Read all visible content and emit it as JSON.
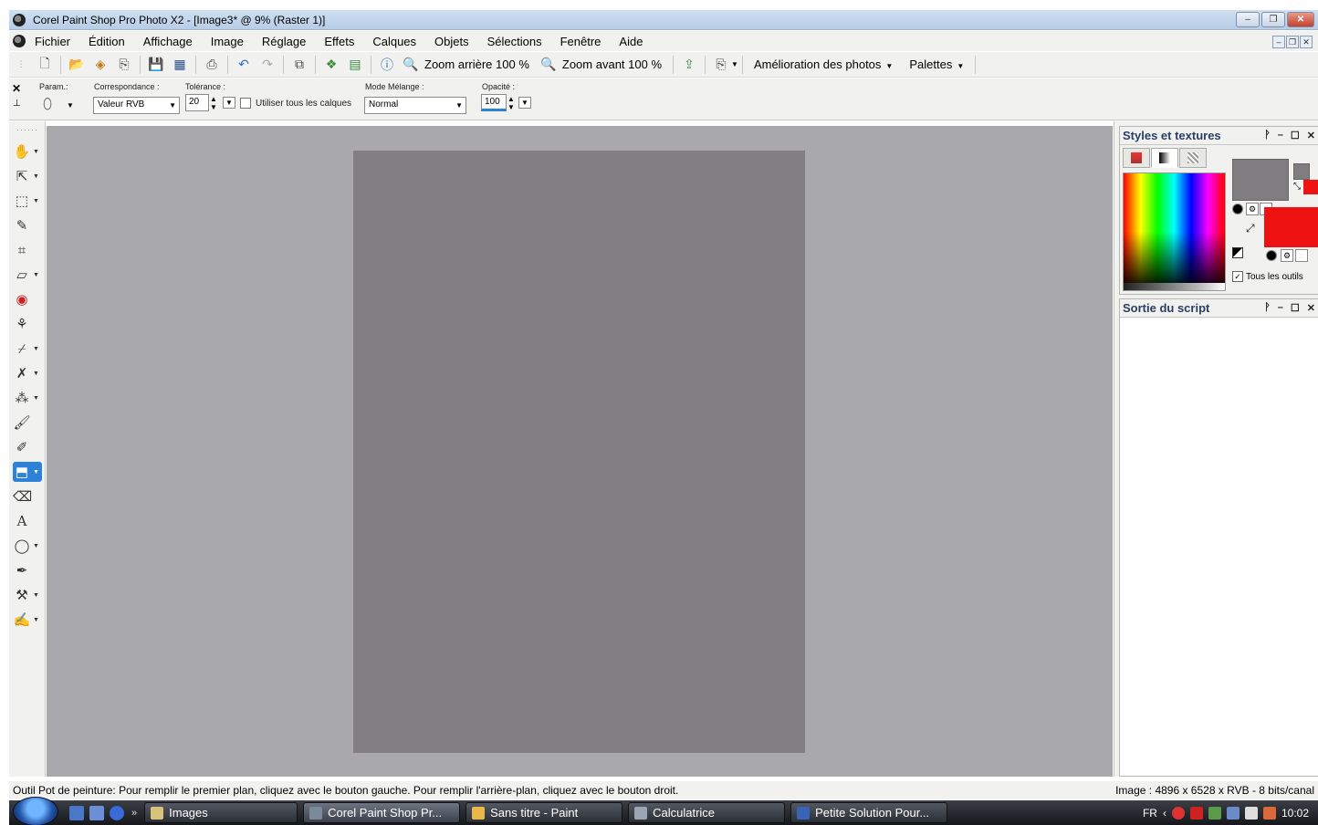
{
  "window": {
    "title": "Corel Paint Shop Pro Photo X2 - [Image3* @  9% (Raster 1)]",
    "min": "–",
    "restore": "❐",
    "close": "✕"
  },
  "menubar": {
    "items": [
      "Fichier",
      "Édition",
      "Affichage",
      "Image",
      "Réglage",
      "Effets",
      "Calques",
      "Objets",
      "Sélections",
      "Fenêtre",
      "Aide"
    ]
  },
  "toolbar": {
    "zoom_out": "Zoom arrière 100 %",
    "zoom_in": "Zoom avant 100 %",
    "enhance": "Amélioration des photos",
    "palettes": "Palettes"
  },
  "options": {
    "param_label": "Param.:",
    "match_label": "Correspondance :",
    "match_value": "Valeur RVB",
    "tolerance_label": "Tolérance :",
    "tolerance_value": "20",
    "all_layers_label": "Utiliser tous les calques",
    "blend_label": "Mode Mélange :",
    "blend_value": "Normal",
    "opacity_label": "Opacité :",
    "opacity_value": "100"
  },
  "palettes": {
    "styles_title": "Styles et textures",
    "all_tools_label": "Tous les outils",
    "all_tools_checked": "✓",
    "script_title": "Sortie du script",
    "foreground_color": "#7f7d80",
    "background_color": "#ef1212"
  },
  "canvas": {
    "color": "#827f83",
    "workspace_color": "#a9a8ab"
  },
  "status": {
    "hint": "Outil Pot de peinture: Pour remplir le premier plan, cliquez avec le bouton gauche. Pour remplir l'arrière-plan, cliquez avec le bouton droit.",
    "image_info": "Image :  4896 x 6528 x RVB - 8 bits/canal"
  },
  "taskbar": {
    "tasks": [
      "Images",
      "Corel Paint Shop Pr...",
      "Sans titre - Paint",
      "Calculatrice",
      "Petite Solution Pour..."
    ],
    "lang": "FR",
    "clock": "10:02"
  }
}
